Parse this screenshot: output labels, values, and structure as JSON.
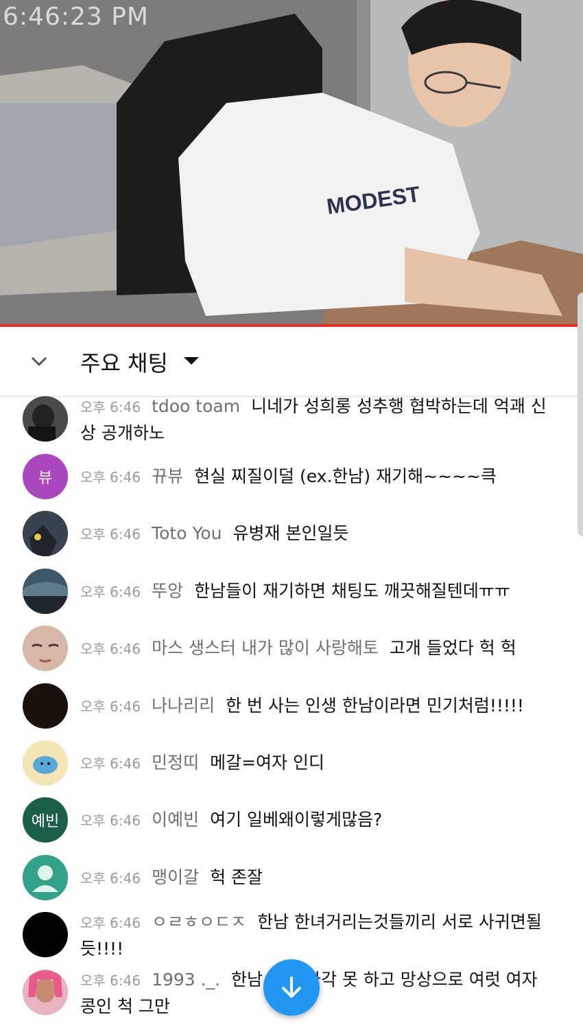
{
  "video": {
    "overlay_time": "6:46:23 PM",
    "progress_color": "#e52d27"
  },
  "header": {
    "title": "주요 채팅",
    "collapse_icon": "chevron-down-icon",
    "dropdown_icon": "caret-down-icon"
  },
  "messages": [
    {
      "time": "오후 6:46",
      "author": "tdoo toam",
      "text": "니네가 성희롱 성추행 협박하는데 억괘 신상 공개하노",
      "avatar": "photo-dark"
    },
    {
      "time": "오후 6:46",
      "author": "뀨뷰",
      "text": "현실 찌질이덜 (ex.한남) 재기해~~~~큭",
      "avatar_initials": "뷰",
      "avatar_color": "#ab47bc"
    },
    {
      "time": "오후 6:46",
      "author": "Toto You",
      "text": "유병재 본인일듯",
      "avatar": "photo-blue"
    },
    {
      "time": "오후 6:46",
      "author": "뚜앙",
      "text": "한남들이 재기하면 채팅도 깨끗해질텐데ㅠㅠ",
      "avatar": "photo-sky"
    },
    {
      "time": "오후 6:46",
      "author": "마스 생스터 내가 많이 사랑해토",
      "text": "고개 들었다 헉 헉",
      "avatar": "photo-face"
    },
    {
      "time": "오후 6:46",
      "author": "나나리리",
      "text": "한 번 사는 인생 한남이라면 민기처럼!!!!!",
      "avatar": "photo-black"
    },
    {
      "time": "오후 6:46",
      "author": "민정띠",
      "text": "메갈=여자 인디",
      "avatar": "photo-cartoon"
    },
    {
      "time": "오후 6:46",
      "author": "이예빈",
      "text": "여기 일베왜이렇게많음?",
      "avatar_initials": "예빈",
      "avatar_color": "#1b5e4a"
    },
    {
      "time": "오후 6:46",
      "author": "맹이갈",
      "text": "헉 존잘",
      "avatar": "default-person"
    },
    {
      "time": "오후 6:46",
      "author": "ㅇㄹㅎㅇㄷㅈ",
      "text": "한남 한녀거리는것들끼리 서로 사귀면될듯!!!!",
      "avatar": "photo-black"
    },
    {
      "time": "오후 6:46",
      "author": "1993 ._.",
      "text": "한남         현실 자각 못 하고 망상으로 여럿 여자 콩인 척 그만",
      "avatar": "photo-pink"
    }
  ],
  "scroll_button": {
    "icon": "arrow-down-icon",
    "color": "#2196f3"
  }
}
